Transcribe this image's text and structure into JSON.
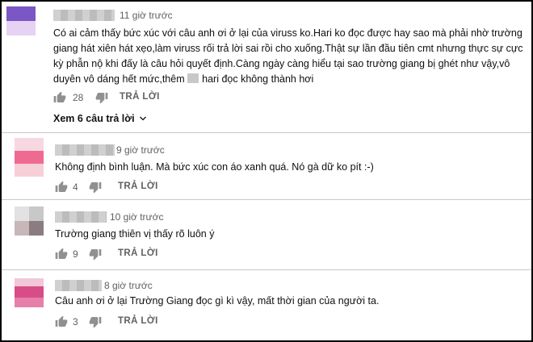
{
  "comments": [
    {
      "time": "11 giờ trước",
      "text_lines": [
        "Có ai cảm thấy bức xúc với câu anh ơi ở lại của viruss ko.Hari ko đọc được hay sao mà phải nhờ trường",
        "giang hát xiên hát xẹo,làm viruss rối trả lời sai rồi cho xuống.Thật sự lần đầu tiên cmt nhưng thực sự cực",
        "kỳ phẫn nộ khi đấy là câu hỏi quyết định.Càng ngày càng hiểu tại sao trường giang bị ghét như vậy,vô",
        "duyên vô dáng hết mức,thêm",
        "hari đọc không thành hơi"
      ],
      "likes": "28",
      "reply_label": "TRẢ LỜI",
      "view_replies": "Xem 6 câu trả lời",
      "avatar_colors": [
        "#7a57c4",
        "#e6d2f2"
      ]
    },
    {
      "time": "9 giờ trước",
      "text": "Không định bình luận. Mà bức xúc con áo xanh quá. Nó gà dữ ko pít :-)",
      "likes": "4",
      "reply_label": "TRẢ LỜI",
      "avatar_colors": [
        "#f7d8e0",
        "#ef6a90",
        "#f6cfd9"
      ]
    },
    {
      "time": "10 giờ trước",
      "text": "Trường giang thiên vị thấy rõ luôn ý",
      "likes": "9",
      "reply_label": "TRẢ LỜI",
      "avatar_colors": [
        "#e2e2e2",
        "#c8c8c8",
        "#c8b6b8",
        "#8a7c80"
      ]
    },
    {
      "time": "8 giờ trước",
      "text": "Câu anh ơi ở lại Trường Giang đọc gì kì vậy, mất thời gian của người ta.",
      "likes": "3",
      "reply_label": "TRẢ LỜI",
      "avatar_colors": [
        "#f2c7d8",
        "#d84d88",
        "#e680a8"
      ]
    }
  ],
  "icons": {
    "like": "thumbs-up-icon",
    "dislike": "thumbs-down-icon",
    "expand": "chevron-down-icon"
  }
}
